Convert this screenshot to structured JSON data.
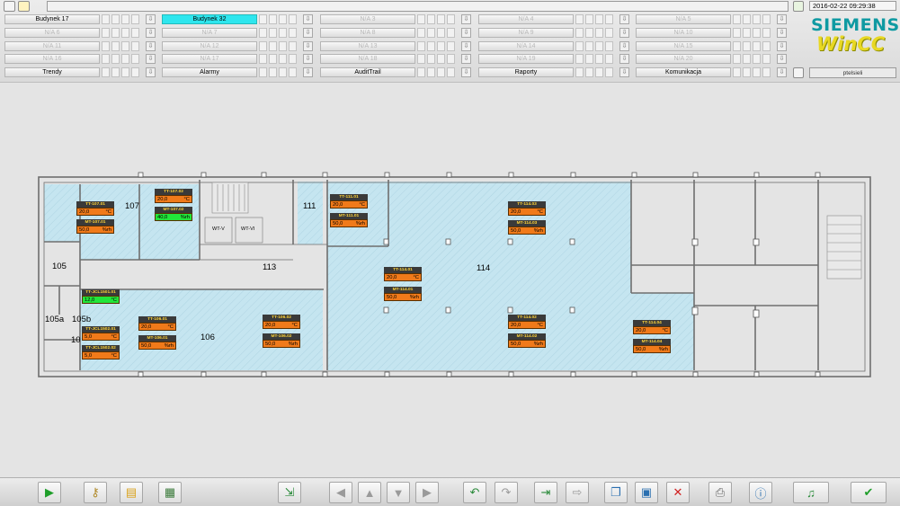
{
  "header": {
    "datetime": "2016-02-22 09:29:38",
    "brand": "SIEMENS",
    "product": "WinCC",
    "user": "ptelsieli"
  },
  "nav": {
    "rows": [
      [
        "Budynek 17",
        "Budynek 32",
        "N/A 3",
        "N/A 4",
        "N/A 5"
      ],
      [
        "N/A 6",
        "N/A 7",
        "N/A 8",
        "N/A 9",
        "N/A 10"
      ],
      [
        "N/A 11",
        "N/A 12",
        "N/A 13",
        "N/A 14",
        "N/A 15"
      ],
      [
        "N/A 16",
        "N/A 17",
        "N/A 18",
        "N/A 19",
        "N/A 20"
      ]
    ],
    "bottom": [
      "Trendy",
      "Alarmy",
      "AuditTrail",
      "Raporty",
      "Komunikacja"
    ]
  },
  "rooms": {
    "r107": "107",
    "r111": "111",
    "r105": "105",
    "r113": "113",
    "r114": "114",
    "r105a": "105a",
    "r105b": "105b",
    "r106": "106",
    "r10": "10",
    "wtv": "WT-V",
    "wtvi": "WT-VI"
  },
  "tags": {
    "tt107_01": {
      "name": "TT-107.01",
      "value": "20,0",
      "unit": "°C"
    },
    "mt107_01": {
      "name": "MT-107.01",
      "value": "50,0",
      "unit": "%rh"
    },
    "tt107_02": {
      "name": "TT-107.02",
      "value": "20,0",
      "unit": "°C"
    },
    "mt107_02": {
      "name": "MT-107.02",
      "value": "40,0",
      "unit": "%rh"
    },
    "tt111_01": {
      "name": "TT-111.01",
      "value": "20,0",
      "unit": "°C"
    },
    "mt111_01": {
      "name": "MT-111.01",
      "value": "50,0",
      "unit": "%rh"
    },
    "tt114_03": {
      "name": "TT-114.03",
      "value": "20,0",
      "unit": "°C"
    },
    "mt114_03": {
      "name": "MT-114.03",
      "value": "50,0",
      "unit": "%rh"
    },
    "tt114_01": {
      "name": "TT-114.01",
      "value": "20,0",
      "unit": "°C"
    },
    "mt114_01": {
      "name": "MT-114.01",
      "value": "50,0",
      "unit": "%rh"
    },
    "ttjcl1501": {
      "name": "TT-JCL1501.01",
      "value": "12,0",
      "unit": "°C"
    },
    "ttjcl1502_01": {
      "name": "TT-JCL1502.01",
      "value": "5,0",
      "unit": "°C"
    },
    "ttjcl1502_02": {
      "name": "TT-JCL1502.02",
      "value": "5,0",
      "unit": "°C"
    },
    "tt106_01": {
      "name": "TT-106.01",
      "value": "20,0",
      "unit": "°C"
    },
    "mt106_01": {
      "name": "MT-106.01",
      "value": "50,0",
      "unit": "%rh"
    },
    "tt106_02": {
      "name": "TT-106.02",
      "value": "20,0",
      "unit": "°C"
    },
    "mt106_02": {
      "name": "MT-106.02",
      "value": "50,0",
      "unit": "%rh"
    },
    "tt114_02": {
      "name": "TT-114.02",
      "value": "20,0",
      "unit": "°C"
    },
    "mt114_02": {
      "name": "MT-114.02",
      "value": "50,0",
      "unit": "%rh"
    },
    "tt114_04": {
      "name": "TT-114.04",
      "value": "20,0",
      "unit": "°C"
    },
    "mt114_04": {
      "name": "MT-114.04",
      "value": "50,0",
      "unit": "%rh"
    }
  },
  "colors": {
    "alarm": "#f07a1a",
    "ok": "#22e63a",
    "selected": "#2ee6ee",
    "room_fill": "#c5e5f0"
  },
  "toolbar_icons": [
    "play-icon",
    "key-icon",
    "folder-icon",
    "report-icon",
    "export-icon",
    "left-arrow-icon",
    "up-arrow-icon",
    "down-arrow-icon",
    "right-arrow-icon",
    "undo-icon",
    "redo-icon",
    "import-icon",
    "forward-icon",
    "copy-icon",
    "save-icon",
    "delete-icon",
    "print-icon",
    "info-icon",
    "sound-icon",
    "acknowledge-icon"
  ]
}
